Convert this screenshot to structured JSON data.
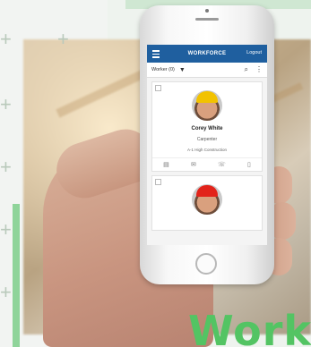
{
  "app": {
    "title": "WORKFORCE",
    "logout_label": "Logout"
  },
  "filter": {
    "selected": "Worker (0)",
    "caret": "▼",
    "search_icon": "⌕",
    "more_icon": "⋮"
  },
  "cards": [
    {
      "name": "Corey White",
      "role": "Carpenter",
      "company": "A-1 High Construction",
      "helmet_color": "#f2c200",
      "actions": [
        "▤",
        "✉",
        "☏",
        "▯"
      ]
    },
    {
      "name": "",
      "role": "",
      "company": "",
      "helmet_color": "#e2231a",
      "actions": []
    }
  ],
  "brand": {
    "text": "Workf"
  },
  "colors": {
    "header_blue": "#1f5f9f",
    "brand_green": "#53c463"
  },
  "icons": [
    "menu-icon",
    "search-icon",
    "more-vertical-icon",
    "id-card-icon",
    "mail-icon",
    "phone-icon",
    "bookmark-icon",
    "plus-icon"
  ]
}
